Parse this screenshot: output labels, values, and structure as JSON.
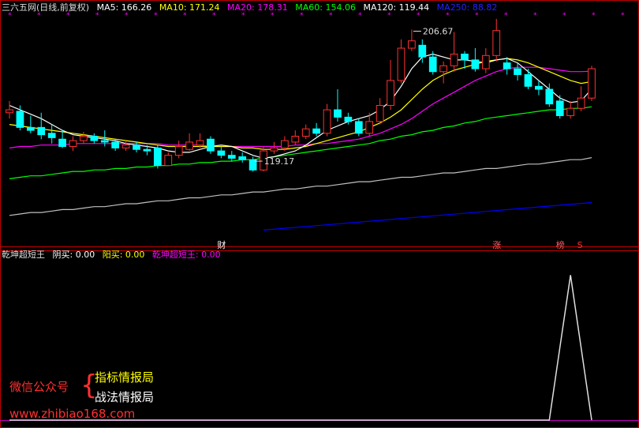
{
  "header": {
    "title": "三六五网(日线,前复权)",
    "ma": [
      {
        "label": "MA5: 166.26",
        "color": "#ffffff"
      },
      {
        "label": "MA10: 171.24",
        "color": "#ffff00"
      },
      {
        "label": "MA20: 178.31",
        "color": "#ff00ff"
      },
      {
        "label": "MA60: 154.06",
        "color": "#00ff00"
      },
      {
        "label": "MA120: 119.44",
        "color": "#ffffff"
      },
      {
        "label": "MA250: 88.82",
        "color": "#0000ff"
      }
    ]
  },
  "sub_header": {
    "items": [
      {
        "label": "乾坤超短王",
        "color": "#dddddd"
      },
      {
        "label": "阴买: 0.00",
        "color": "#ffffff"
      },
      {
        "label": "阳买: 0.00",
        "color": "#ffff00"
      },
      {
        "label": "乾坤超短王: 0.00",
        "color": "#ff00ff"
      }
    ]
  },
  "watermark": {
    "wechat": "微信公众号",
    "brace": "{",
    "line1": "指标情报局",
    "line2": "战法情报局",
    "url": "www.zhibiao168.com"
  },
  "chart_data": [
    {
      "type": "candlestick",
      "title": "三六五网(日线,前复权)",
      "ylim": [
        60,
        215
      ],
      "annotations": [
        {
          "text": "206.67",
          "value": 206.67,
          "kind": "high"
        },
        {
          "text": "119.17",
          "value": 119.17,
          "kind": "low"
        }
      ],
      "event_markers": [
        "财",
        "涨",
        "榜",
        "S"
      ],
      "candles": [
        [
          150,
          152,
          158,
          146
        ],
        [
          151,
          140,
          155,
          138
        ],
        [
          140,
          138,
          148,
          136
        ],
        [
          140,
          135,
          150,
          132
        ],
        [
          136,
          133,
          142,
          129
        ],
        [
          132,
          127,
          138,
          126
        ],
        [
          127,
          131,
          134,
          124
        ],
        [
          131,
          134,
          137,
          129
        ],
        [
          134,
          131,
          136,
          129
        ],
        [
          131,
          130,
          138,
          127
        ],
        [
          130,
          126,
          132,
          124
        ],
        [
          126,
          128,
          131,
          124
        ],
        [
          128,
          125,
          130,
          123
        ],
        [
          125,
          124,
          128,
          121
        ],
        [
          126,
          114,
          128,
          112
        ],
        [
          114,
          121,
          123,
          119.17
        ],
        [
          121,
          127,
          131,
          119
        ],
        [
          125,
          130,
          136,
          124
        ],
        [
          128,
          131,
          136,
          126
        ],
        [
          132,
          124,
          134,
          122
        ],
        [
          124,
          121,
          127,
          119
        ],
        [
          121,
          119,
          124,
          117
        ],
        [
          120,
          118,
          123,
          116
        ],
        [
          118,
          111,
          120,
          110
        ],
        [
          111,
          124,
          127,
          110
        ],
        [
          124,
          126,
          130,
          122
        ],
        [
          126,
          131,
          134,
          124
        ],
        [
          130,
          134,
          138,
          128
        ],
        [
          134,
          139,
          142,
          132
        ],
        [
          139,
          136,
          143,
          134
        ],
        [
          136,
          152,
          156,
          134
        ],
        [
          152,
          147,
          166,
          144
        ],
        [
          147,
          144,
          150,
          142
        ],
        [
          144,
          136,
          146,
          134
        ],
        [
          136,
          144,
          150,
          134
        ],
        [
          144,
          155,
          160,
          142
        ],
        [
          155,
          172,
          186,
          152
        ],
        [
          172,
          194,
          200,
          170
        ],
        [
          194,
          199,
          206.67,
          192
        ],
        [
          196,
          188,
          200,
          184
        ],
        [
          188,
          178,
          192,
          176
        ],
        [
          178,
          182,
          185,
          170
        ],
        [
          182,
          190,
          205,
          178
        ],
        [
          190,
          186,
          192,
          180
        ],
        [
          186,
          180,
          194,
          178
        ],
        [
          180,
          189,
          194,
          177
        ],
        [
          189,
          206,
          214,
          185
        ],
        [
          184,
          180,
          188,
          176
        ],
        [
          180,
          176,
          184,
          172
        ],
        [
          176,
          168,
          180,
          166
        ],
        [
          168,
          166,
          172,
          162
        ],
        [
          166,
          156,
          170,
          154
        ],
        [
          158,
          148,
          162,
          146
        ],
        [
          148,
          153,
          158,
          146
        ],
        [
          153,
          160,
          168,
          151
        ],
        [
          160,
          180,
          182,
          158
        ]
      ],
      "ma": {
        "MA5": [
          155,
          152,
          149,
          146,
          142,
          138,
          135,
          134,
          133,
          132,
          131,
          129,
          128,
          127,
          126,
          124,
          123,
          123,
          125,
          127,
          128,
          127,
          124,
          121,
          119,
          120,
          122,
          124,
          128,
          133,
          138,
          141,
          144,
          146,
          148,
          152,
          158,
          168,
          180,
          188,
          190,
          188,
          186,
          186,
          185,
          184,
          186,
          187,
          184,
          178,
          172,
          166,
          160,
          157,
          158,
          166.26
        ],
        "MA10": [
          142,
          141,
          140,
          139,
          138,
          137,
          136,
          135,
          134,
          133,
          132,
          131,
          130,
          129,
          128,
          127,
          127,
          127,
          127,
          127,
          127,
          127,
          126,
          126,
          125,
          125,
          125,
          126,
          127,
          129,
          131,
          133,
          135,
          137,
          140,
          143,
          147,
          152,
          159,
          166,
          172,
          176,
          179,
          181,
          183,
          185,
          186,
          187,
          186,
          184,
          181,
          178,
          175,
          172,
          170,
          171.24
        ],
        "MA20": [
          126,
          127,
          127,
          128,
          128,
          128,
          129,
          129,
          129,
          129,
          129,
          129,
          129,
          129,
          129,
          128,
          128,
          128,
          128,
          127,
          127,
          127,
          127,
          127,
          127,
          127,
          127,
          128,
          128,
          129,
          129,
          130,
          131,
          132,
          134,
          136,
          139,
          142,
          146,
          151,
          156,
          160,
          164,
          168,
          172,
          175,
          178,
          180,
          181,
          181,
          181,
          180,
          179,
          178,
          178,
          178.31
        ],
        "MA60": [
          105,
          106,
          107,
          107,
          108,
          109,
          110,
          110,
          111,
          111,
          112,
          112,
          113,
          113,
          114,
          114,
          115,
          115,
          116,
          116,
          117,
          117,
          118,
          118,
          119,
          120,
          121,
          122,
          123,
          124,
          125,
          126,
          127,
          128,
          129,
          131,
          132,
          134,
          135,
          137,
          138,
          140,
          141,
          143,
          144,
          146,
          147,
          148,
          149,
          150,
          151,
          152,
          152,
          153,
          153,
          154.06
        ],
        "MA120": [
          80,
          81,
          82,
          82,
          83,
          84,
          84,
          85,
          86,
          86,
          87,
          88,
          88,
          89,
          90,
          90,
          91,
          92,
          92,
          93,
          94,
          94,
          95,
          96,
          96,
          97,
          98,
          98,
          99,
          100,
          100,
          101,
          102,
          103,
          103,
          104,
          105,
          106,
          106,
          107,
          108,
          109,
          109,
          110,
          111,
          112,
          112,
          113,
          114,
          115,
          115,
          116,
          117,
          118,
          118,
          119.44
        ],
        "MA250": [
          null,
          null,
          null,
          null,
          null,
          null,
          null,
          null,
          null,
          null,
          null,
          null,
          null,
          null,
          null,
          null,
          null,
          null,
          null,
          null,
          null,
          null,
          null,
          null,
          null,
          null,
          null,
          null,
          null,
          null,
          null,
          null,
          null,
          null,
          null,
          null,
          null,
          null,
          null,
          null,
          null,
          null,
          null,
          null,
          null,
          null,
          null,
          null,
          null,
          null,
          null,
          null,
          null,
          null,
          null,
          88.82
        ],
        "MA250_path": [
          [
            24,
            70
          ],
          [
            55,
            88.82
          ]
        ]
      },
      "ma_colors": {
        "MA5": "#ffffff",
        "MA10": "#ffff00",
        "MA20": "#ff00ff",
        "MA60": "#00ff00",
        "MA120": "#c0c0c0",
        "MA250": "#0000ff"
      }
    },
    {
      "type": "line",
      "title": "乾坤超短王",
      "series": [
        {
          "name": "乾坤超短王",
          "values": [
            0,
            0,
            0,
            0,
            0,
            0,
            0,
            0,
            0,
            0,
            0,
            0,
            0,
            0,
            0,
            0,
            0,
            0,
            0,
            0,
            0,
            0,
            0,
            0,
            0,
            0,
            0,
            0,
            0,
            0,
            0,
            0,
            0,
            0,
            0,
            0,
            0,
            0,
            0,
            0,
            0,
            0,
            0,
            0,
            0,
            0,
            0,
            0,
            0,
            0,
            0,
            0,
            0.5,
            1,
            0.5,
            0
          ]
        }
      ],
      "ylim": [
        0,
        1.1
      ]
    }
  ]
}
